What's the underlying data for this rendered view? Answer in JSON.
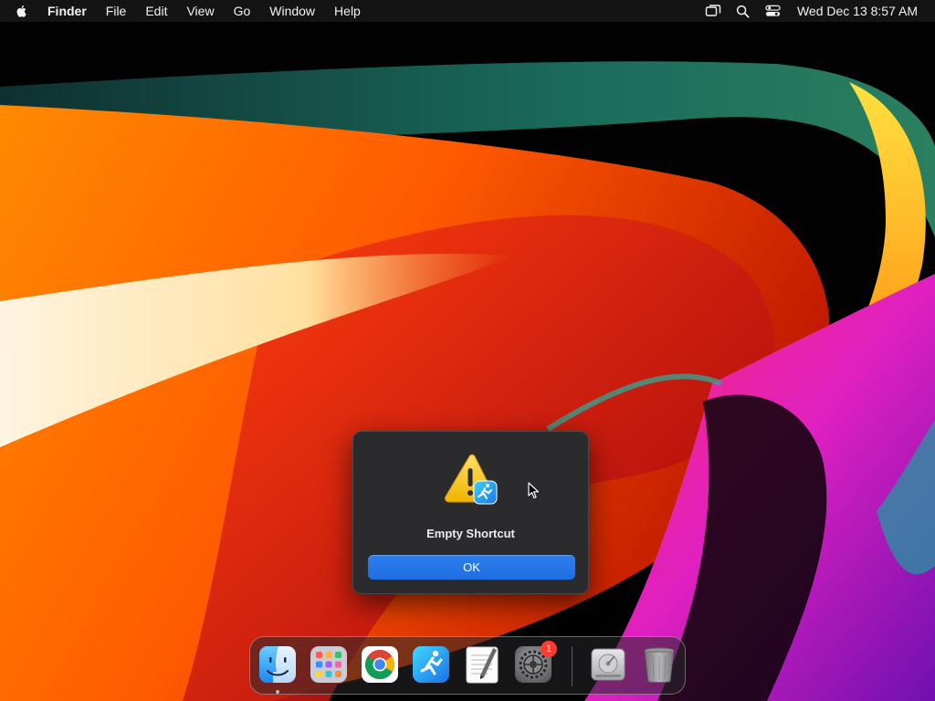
{
  "menubar": {
    "apple_icon": "apple-logo-icon",
    "app_name": "Finder",
    "menus": [
      "File",
      "Edit",
      "View",
      "Go",
      "Window",
      "Help"
    ],
    "status_icons": [
      "screen-mirroring-icon",
      "spotlight-search-icon",
      "control-center-icon"
    ],
    "clock": "Wed Dec 13  8:57 AM"
  },
  "alert": {
    "icon": "warning-triangle-icon",
    "badge_icon": "shortcuts-app-icon",
    "title": "Empty Shortcut",
    "ok_label": "OK"
  },
  "dock": {
    "apps": [
      {
        "name": "Finder",
        "icon": "finder-icon",
        "running": true
      },
      {
        "name": "Launchpad",
        "icon": "launchpad-icon"
      },
      {
        "name": "Google Chrome",
        "icon": "chrome-icon"
      },
      {
        "name": "Shortcuts",
        "icon": "shortcuts-icon"
      },
      {
        "name": "TextEdit",
        "icon": "textedit-icon"
      },
      {
        "name": "System Settings",
        "icon": "system-settings-icon",
        "badge": "1"
      },
      {
        "name": "Disk",
        "icon": "disk-icon"
      },
      {
        "name": "Trash",
        "icon": "trash-icon"
      }
    ]
  },
  "colors": {
    "accent_button": "#1f6ee0",
    "dialog_bg": "#2b2b2d",
    "badge": "#ff3b30"
  }
}
